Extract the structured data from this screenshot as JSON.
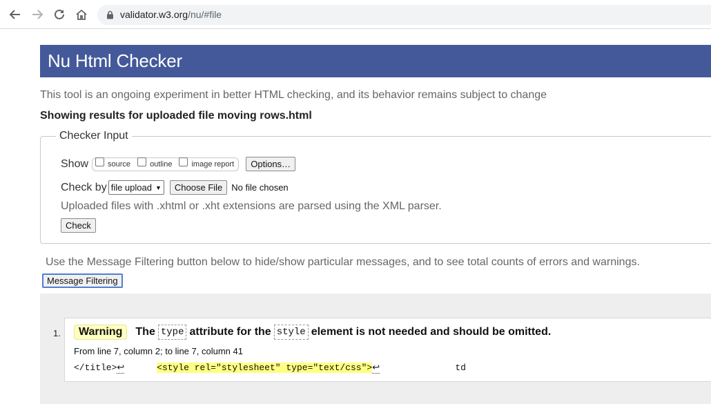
{
  "browser": {
    "url_host": "validator.w3.org",
    "url_path": "/nu/#file"
  },
  "header": {
    "title": "Nu Html Checker"
  },
  "tagline": "This tool is an ongoing experiment in better HTML checking, and its behavior remains subject to change",
  "showing": "Showing results for uploaded file moving rows.html",
  "checker_input": {
    "legend": "Checker Input",
    "show_label": "Show",
    "show_options": [
      "source",
      "outline",
      "image report"
    ],
    "options_button": "Options…",
    "check_by_label": "Check by",
    "check_by_value": "file upload",
    "choose_file_button": "Choose File",
    "no_file_text": "No file chosen",
    "xml_note": "Uploaded files with .xhtml or .xht extensions are parsed using the XML parser.",
    "check_button": "Check"
  },
  "filtering": {
    "note": "Use the Message Filtering button below to hide/show particular messages, and to see total counts of errors and warnings.",
    "button": "Message Filtering"
  },
  "messages": [
    {
      "number": "1.",
      "severity": "Warning",
      "text_1": "The",
      "code_1": "type",
      "text_2": "attribute for the",
      "code_2": "style",
      "text_3": "element is not needed and should be omitted.",
      "location": "From line 7, column 2; to line 7, column 41",
      "extract_before": "</title>",
      "extract_gap": "      ",
      "extract_highlight": "<style rel=\"stylesheet\" type=\"text/css\">",
      "extract_after_gap": "              ",
      "extract_after": "td",
      "line_feed_symbol": "↩"
    }
  ]
}
